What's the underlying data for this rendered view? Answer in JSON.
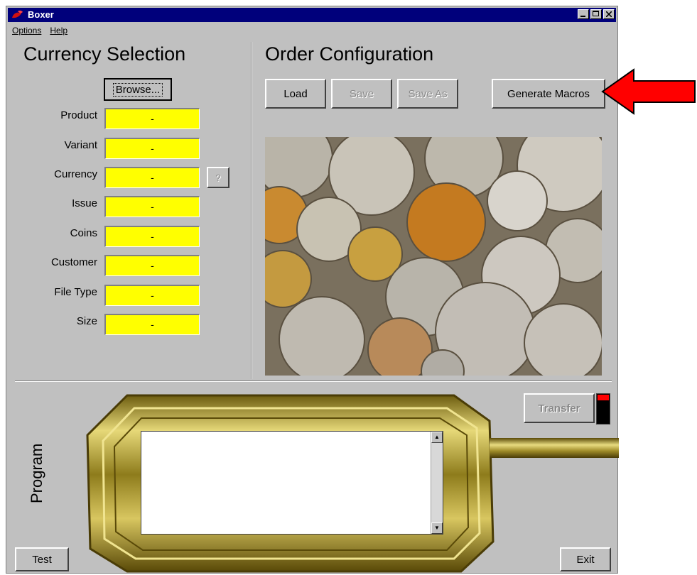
{
  "window": {
    "title": "Boxer"
  },
  "menu": {
    "options": "Options",
    "help": "Help"
  },
  "currency": {
    "heading": "Currency Selection",
    "browse_label": "Browse...",
    "query_label": "?",
    "fields": [
      {
        "label": "Product",
        "value": "-"
      },
      {
        "label": "Variant",
        "value": "-"
      },
      {
        "label": "Currency",
        "value": "-"
      },
      {
        "label": "Issue",
        "value": "-"
      },
      {
        "label": "Coins",
        "value": "-"
      },
      {
        "label": "Customer",
        "value": "-"
      },
      {
        "label": "File Type",
        "value": "-"
      },
      {
        "label": "Size",
        "value": "-"
      }
    ]
  },
  "order": {
    "heading": "Order Configuration",
    "load_label": "Load",
    "save_label": "Save",
    "save_as_label": "Save As",
    "generate_label": "Generate Macros"
  },
  "program": {
    "label": "Program",
    "transfer_label": "Transfer"
  },
  "footer": {
    "test_label": "Test",
    "exit_label": "Exit"
  },
  "colors": {
    "field_bg": "#ffff00",
    "titlebar": "#00007b",
    "arrow": "#ff0000",
    "gold": "#b8a23a"
  }
}
